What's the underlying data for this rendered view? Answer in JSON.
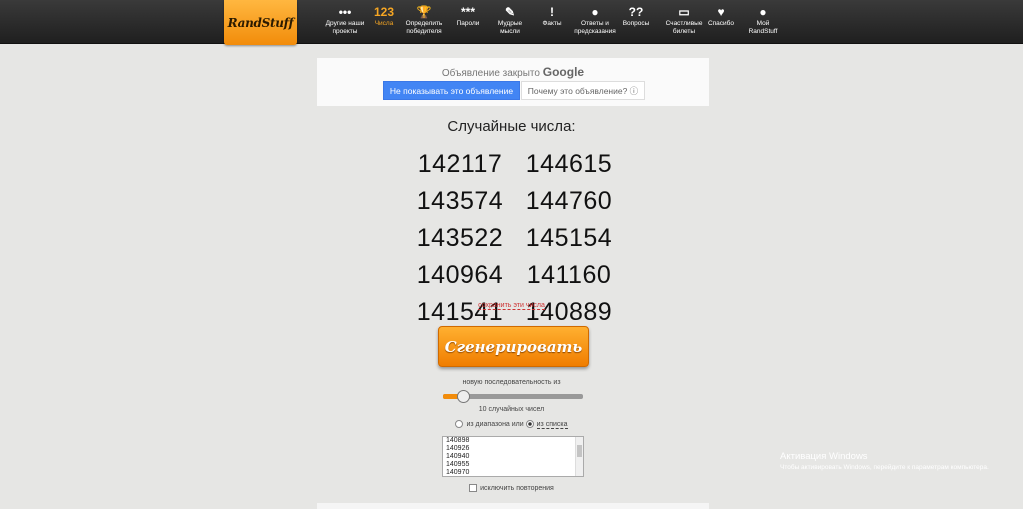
{
  "logo": {
    "text": "RandStuff"
  },
  "nav": [
    {
      "icon": "dots-icon",
      "glyph": "•••",
      "label": "Другие наши\nпроекты"
    },
    {
      "icon": "numbers-icon",
      "glyph": "123",
      "label": "Числа",
      "active": true
    },
    {
      "icon": "trophy-icon",
      "glyph": "🏆",
      "label": "Определить\nпобедителя"
    },
    {
      "icon": "password-icon",
      "glyph": "***",
      "label": "Пароли"
    },
    {
      "icon": "notes-icon",
      "glyph": "✎",
      "label": "Мудрые\nмысли"
    },
    {
      "icon": "alert-icon",
      "glyph": "!",
      "label": "Факты"
    },
    {
      "icon": "ball-icon",
      "glyph": "●",
      "label": "Ответы и\nпредсказания"
    },
    {
      "icon": "questions-icon",
      "glyph": "??",
      "label": "Вопросы"
    },
    {
      "icon": "ticket-icon",
      "glyph": "▭",
      "label": "Счастливые\nбилеты"
    },
    {
      "icon": "heart-icon",
      "glyph": "♥",
      "label": "Спасибо"
    },
    {
      "icon": "user-icon",
      "glyph": "●",
      "label": "Мой\nRandStuff"
    }
  ],
  "ad": {
    "closed_prefix": "Объявление закрыто",
    "closed_brand": "Google",
    "hide_button": "Не показывать это объявление",
    "why_button": "Почему это объявление? ⓘ"
  },
  "title": "Случайные числа:",
  "numbers": [
    "142117",
    "144615",
    "143574",
    "144760",
    "143522",
    "145154",
    "140964",
    "141160",
    "141541",
    "140889"
  ],
  "save_link": "сохранить эти числа",
  "generate_button": "Сгенерировать",
  "sequence_label": "новую последовательность из",
  "slider": {
    "fraction": 0.14
  },
  "count_label": "10 случайных чисел",
  "radios": {
    "range": "из диапазона или",
    "list": "из списка",
    "selected": "list"
  },
  "list_values": [
    "140898",
    "140926",
    "140940",
    "140955",
    "140970"
  ],
  "exclude_label": "исключить повторения",
  "watermark": {
    "title": "Активация Windows",
    "text": "Чтобы активировать Windows, перейдите к параметрам компьютера."
  }
}
